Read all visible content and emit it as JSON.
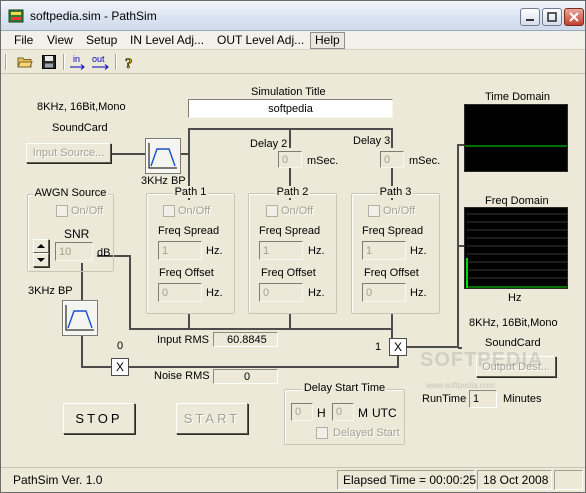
{
  "window": {
    "title": "softpedia.sim - PathSim",
    "controls": [
      "minimize",
      "maximize",
      "close"
    ]
  },
  "menu": [
    "File",
    "View",
    "Setup",
    "IN Level Adj...",
    "OUT Level Adj...",
    "Help"
  ],
  "toolbar": {
    "icons": [
      "open-folder-icon",
      "save-disk-icon",
      "input-level-icon",
      "output-level-icon",
      "help-question-icon"
    ],
    "in_label": "in",
    "out_label": "out"
  },
  "input": {
    "format": "8KHz, 16Bit,Mono",
    "device": "SoundCard",
    "source_button": "Input Source..."
  },
  "simulation": {
    "title_label": "Simulation Title",
    "title_value": "softpedia"
  },
  "bp_filter_top": "3KHz BP",
  "bp_filter_left": "3KHz BP",
  "delays": [
    {
      "label": "Delay 2",
      "value": "0",
      "unit": "mSec."
    },
    {
      "label": "Delay 3",
      "value": "0",
      "unit": "mSec."
    }
  ],
  "awgn": {
    "title": "AWGN Source",
    "onoff": "On/Off",
    "snr_label": "SNR",
    "snr_value": "10",
    "snr_unit": "dB"
  },
  "paths": [
    {
      "title": "Path 1",
      "onoff": "On/Off",
      "spread_label": "Freq Spread",
      "spread_value": "1",
      "spread_unit": "Hz.",
      "offset_label": "Freq Offset",
      "offset_value": "0",
      "offset_unit": "Hz."
    },
    {
      "title": "Path 2",
      "onoff": "On/Off",
      "spread_label": "Freq Spread",
      "spread_value": "1",
      "spread_unit": "Hz.",
      "offset_label": "Freq Offset",
      "offset_value": "0",
      "offset_unit": "Hz."
    },
    {
      "title": "Path 3",
      "onoff": "On/Off",
      "spread_label": "Freq Spread",
      "spread_value": "1",
      "spread_unit": "Hz.",
      "offset_label": "Freq Offset",
      "offset_value": "0",
      "offset_unit": "Hz."
    }
  ],
  "meters": {
    "input_rms_label": "Input RMS",
    "input_rms_value": "60.8845",
    "noise_rms_label": "Noise RMS",
    "noise_rms_value": "0"
  },
  "mixers": {
    "noise_gain": "0",
    "signal_gain": "1",
    "symbol": "X"
  },
  "buttons": {
    "stop": "STOP",
    "start": "START"
  },
  "delay_start": {
    "title": "Delay Start Time",
    "hours_value": "0",
    "hours_unit": "H",
    "minutes_value": "0",
    "minutes_unit": "M",
    "utc": "UTC",
    "delayed_start": "Delayed Start"
  },
  "output": {
    "time_domain_label": "Time Domain",
    "freq_domain_label": "Freq Domain",
    "freq_axis_unit": "Hz",
    "format": "8KHz, 16Bit,Mono",
    "device": "SoundCard",
    "dest_button": "Output Dest...",
    "runtime_label": "RunTime",
    "runtime_value": "1",
    "runtime_unit": "Minutes",
    "trace_color": "#00e000"
  },
  "statusbar": {
    "version": "PathSim Ver.  1.0",
    "elapsed": "Elapsed Time = 00:00:25",
    "date": "18 Oct 2008"
  },
  "watermark": {
    "text": "SOFTPEDIA",
    "url": "www.softpedia.com"
  }
}
